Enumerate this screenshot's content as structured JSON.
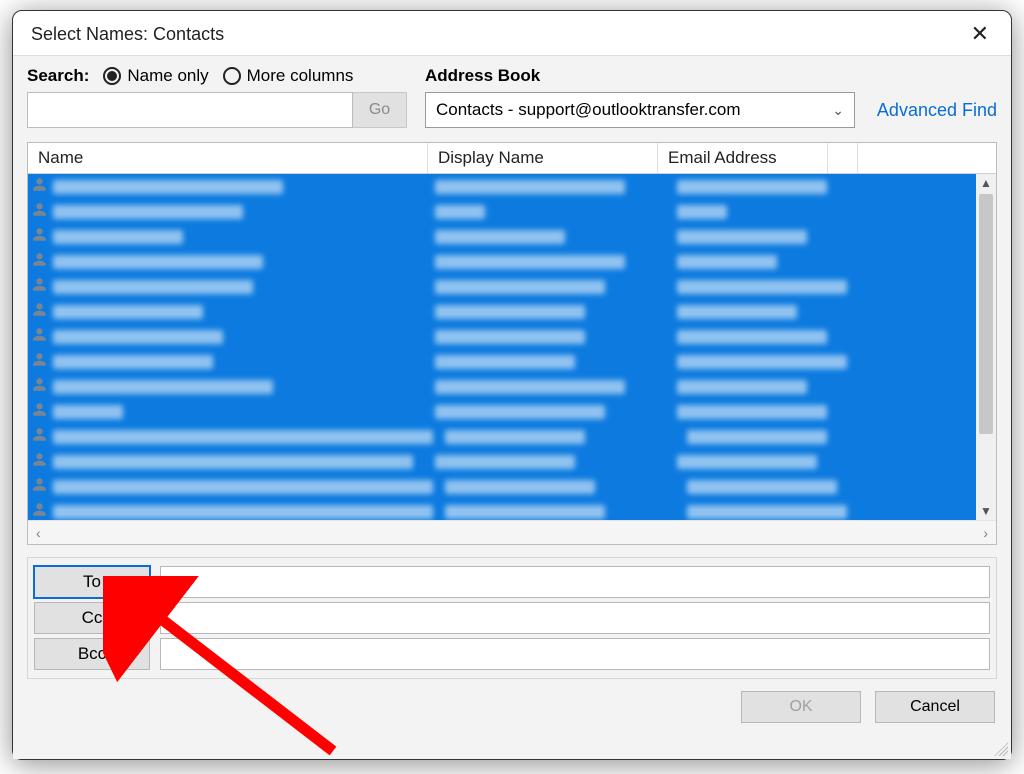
{
  "window": {
    "title": "Select Names: Contacts"
  },
  "search": {
    "label": "Search:",
    "radio_name_only": "Name only",
    "radio_more_columns": "More columns",
    "selected_radio": "name_only",
    "input_value": "",
    "go_label": "Go"
  },
  "address_book": {
    "label": "Address Book",
    "selected": "Contacts - support@outlooktransfer.com",
    "advanced_find": "Advanced Find"
  },
  "grid": {
    "columns": {
      "name": "Name",
      "display": "Display Name",
      "email": "Email Address"
    },
    "row_count": 14,
    "all_selected": true
  },
  "recipients": {
    "to_label": "To",
    "cc_label": "Cc",
    "bcc_label": "Bcc"
  },
  "footer": {
    "ok": "OK",
    "cancel": "Cancel"
  },
  "colors": {
    "selection": "#0c7adf",
    "link": "#0a6cd6",
    "annotation": "#ff0000"
  }
}
